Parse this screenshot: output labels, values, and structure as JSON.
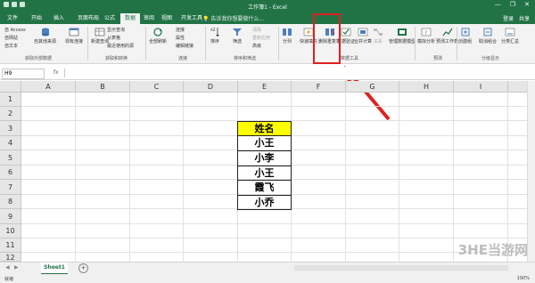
{
  "window": {
    "title": "工作簿1 - Excel",
    "minimize": "—",
    "restore": "❐",
    "close": "✕"
  },
  "tabs": [
    "文件",
    "开始",
    "插入",
    "页面布局",
    "公式",
    "数据",
    "审阅",
    "视图",
    "开发工具"
  ],
  "active_tab_index": 5,
  "tell_me": "告诉我你想要做什么...",
  "tab_right": {
    "login": "登录",
    "share": "共享"
  },
  "ribbon": {
    "get_external": {
      "items": [
        "自 Access",
        "自网站",
        "自文本"
      ],
      "other_source": "自其他来源",
      "existing": "现有连接",
      "title": "获取外部数据"
    },
    "transform": {
      "new_query": "新建查询",
      "items": [
        "显示查询",
        "从表格",
        "最近使用的源"
      ],
      "title": "获取和转换"
    },
    "connections": {
      "refresh": "全部刷新",
      "items": [
        "连接",
        "属性",
        "编辑链接"
      ],
      "title": "连接"
    },
    "sort_filter": {
      "sort": "排序",
      "filter": "筛选",
      "items": [
        "清除",
        "重新应用",
        "高级"
      ],
      "title": "排序和筛选"
    },
    "data_tools": {
      "split": "分列",
      "flash_fill": "快速填充",
      "remove_dup": "删除重复项",
      "validation": "数据验证",
      "consolidate": "合并计算",
      "relationships": "关系",
      "data_model": "管理数据模型",
      "title": "数据工具"
    },
    "forecast": {
      "whatif": "模拟分析",
      "sheet": "预测工作表",
      "title": "预测"
    },
    "outline": {
      "group": "创建组",
      "ungroup": "取消组合",
      "subtotal": "分类汇总",
      "title": "分级显示"
    }
  },
  "formula_bar": {
    "name_box": "H9",
    "fx": "fx"
  },
  "columns": [
    "A",
    "B",
    "C",
    "D",
    "E",
    "F",
    "G",
    "H",
    "I"
  ],
  "rows": [
    "1",
    "2",
    "3",
    "4",
    "5",
    "6",
    "7",
    "8",
    "9",
    "10",
    "11",
    "12"
  ],
  "name_table": {
    "header": "姓名",
    "names": [
      "小王",
      "小李",
      "小王",
      "霞飞",
      "小乔"
    ]
  },
  "sheet_tab": "Sheet1",
  "add_sheet": "+",
  "status": {
    "ready": "就绪",
    "zoom": "190%"
  },
  "watermark": "3HE当游网",
  "colors": {
    "excel_green": "#217346",
    "highlight_red": "#e02020",
    "header_fill": "#ffff00"
  }
}
